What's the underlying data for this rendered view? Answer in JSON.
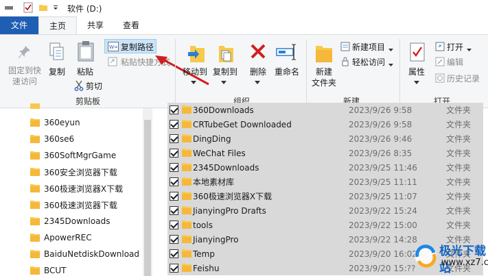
{
  "window": {
    "title": "软件 (D:)"
  },
  "tabs": {
    "file": "文件",
    "home": "主页",
    "share": "共享",
    "view": "查看"
  },
  "ribbon": {
    "clipboard": {
      "pin": "固定到快\n速访问",
      "copy": "复制",
      "paste": "粘贴",
      "copy_path": "复制路径",
      "paste_shortcut": "粘贴快捷方式",
      "cut": "剪切",
      "group": "剪贴板"
    },
    "organize": {
      "move_to": "移动到",
      "copy_to": "复制到",
      "delete": "删除",
      "rename": "重命名",
      "group": "组织"
    },
    "new": {
      "new_folder": "新建\n文件夹",
      "new_item": "新建项目",
      "easy_access": "轻松访问",
      "group": "新建"
    },
    "open": {
      "properties": "属性",
      "open": "打开",
      "edit": "编辑",
      "history": "历史记录",
      "group": "打开"
    }
  },
  "nav": {
    "items": [
      "360eyun",
      "360se6",
      "360SoftMgrGame",
      "360安全浏览器下载",
      "360极速浏览器X下载",
      "360极速浏览器下载",
      "2345Downloads",
      "ApowerREC",
      "BaiduNetdiskDownload",
      "BCUT"
    ]
  },
  "files": [
    {
      "name": "360Downloads",
      "date": "2023/9/26 9:58",
      "type": "文件夹"
    },
    {
      "name": "CRTubeGet Downloaded",
      "date": "2023/9/26 9:58",
      "type": "文件夹"
    },
    {
      "name": "DingDing",
      "date": "2023/9/26 9:46",
      "type": "文件夹"
    },
    {
      "name": "WeChat Files",
      "date": "2023/9/26 8:35",
      "type": "文件夹"
    },
    {
      "name": "2345Downloads",
      "date": "2023/9/25 11:46",
      "type": "文件夹"
    },
    {
      "name": "本地素材库",
      "date": "2023/9/25 11:11",
      "type": "文件夹"
    },
    {
      "name": "360极速浏览器X下载",
      "date": "2023/9/25 11:07",
      "type": "文件夹"
    },
    {
      "name": "JianyingPro Drafts",
      "date": "2023/9/22 15:24",
      "type": "文件夹"
    },
    {
      "name": "tools",
      "date": "2023/9/22 15:00",
      "type": "文件夹"
    },
    {
      "name": "JianyingPro",
      "date": "2023/9/22 14:28",
      "type": "文件夹"
    },
    {
      "name": "Temp",
      "date": "2023/9/20 16:02",
      "type": "文件夹"
    },
    {
      "name": "Feishu",
      "date": "2023/9/20 15:??",
      "type": "文件夹"
    }
  ],
  "watermark": {
    "line1": "极光下载站",
    "line2": "www.xz7.com"
  },
  "colors": {
    "file_tab": "#1f5fb3",
    "row_selected": "#d9d9d9",
    "arrow": "#d01f1f",
    "folder": "#f8c94a"
  }
}
